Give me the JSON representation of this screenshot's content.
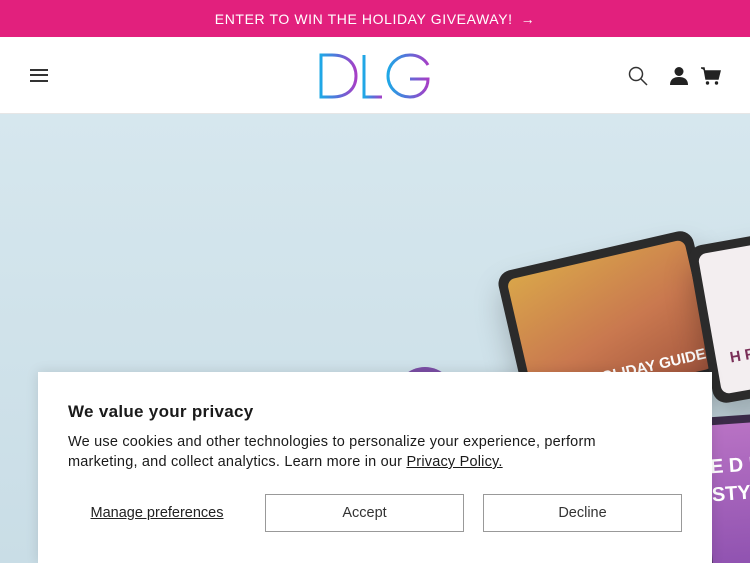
{
  "announcement": {
    "text": "ENTER TO WIN THE HOLIDAY GIVEAWAY!",
    "arrow": "→"
  },
  "header": {
    "logo_text": "DLG",
    "icons": [
      "menu-icon",
      "search-icon",
      "account-icon",
      "cart-icon"
    ]
  },
  "hero": {
    "tablet_left_text": "HOLIDAY GUIDE",
    "tablet_right_text": "H FOO CHRIST",
    "tablet_bottom_text": "E D DA STYLE"
  },
  "cookie": {
    "title": "We value your privacy",
    "message": "We use cookies and other technologies to personalize your experience, perform marketing, and collect analytics. Learn more in our",
    "policy_link": "Privacy Policy.",
    "manage_label": "Manage preferences",
    "accept_label": "Accept",
    "decline_label": "Decline"
  },
  "colors": {
    "announcement_bg": "#e2207d",
    "hero_bg": "#cfe2ea"
  }
}
